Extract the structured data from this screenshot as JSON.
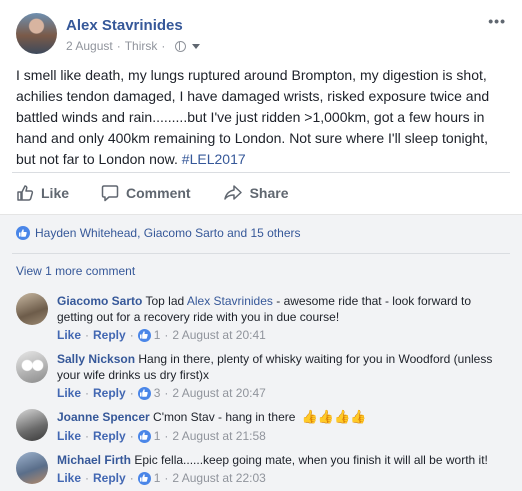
{
  "post": {
    "author": "Alex Stavrinides",
    "date": "2 August",
    "location": "Thirsk",
    "more_label": "•••",
    "text": "I smell like death, my lungs ruptured around Brompton, my digestion is shot, achilies tendon damaged, I have damaged wrists, risked exposure twice and battled winds and rain.........but I've just ridden >1,000km, got a few hours in hand and only 400km remaining to London. Not sure where I'll sleep tonight, but not far to London now.",
    "hashtag": "#LEL2017"
  },
  "actions": {
    "like": "Like",
    "comment": "Comment",
    "share": "Share"
  },
  "reactions": {
    "text": "Hayden Whitehead, Giacomo Sarto and 15 others"
  },
  "view_more": "View 1 more comment",
  "comments": [
    {
      "name": "Giacomo Sarto",
      "text_before": "Top lad ",
      "mention": "Alex Stavrinides",
      "text_after": " - awesome ride that - look forward to getting out for a recovery ride with you in due course!",
      "like": "Like",
      "reply": "Reply",
      "likes": "1",
      "time": "2 August at 20:41",
      "avatar_color": "#8a7a6a"
    },
    {
      "name": "Sally Nickson",
      "text_before": "Hang in there, plenty of whisky waiting for you in Woodford (unless your wife drinks us dry first)x",
      "mention": "",
      "text_after": "",
      "like": "Like",
      "reply": "Reply",
      "likes": "3",
      "time": "2 August at 20:47",
      "avatar_color": "#b9b9b9"
    },
    {
      "name": "Joanne Spencer",
      "text_before": "C'mon Stav - hang in there ",
      "mention": "",
      "text_after": "",
      "emoji": "👍👍👍👍",
      "like": "Like",
      "reply": "Reply",
      "likes": "1",
      "time": "2 August at 21:58",
      "avatar_color": "#8b8b8b"
    },
    {
      "name": "Michael Firth",
      "text_before": "Epic fella......keep going mate, when you finish it will all be worth it!",
      "mention": "",
      "text_after": "",
      "like": "Like",
      "reply": "Reply",
      "likes": "1",
      "time": "2 August at 22:03",
      "avatar_color": "#6d7f99"
    }
  ],
  "colors": {
    "link": "#365899",
    "meta": "#90949c",
    "comments_bg": "#f2f3f5",
    "like_blue": "#4a86e8"
  }
}
